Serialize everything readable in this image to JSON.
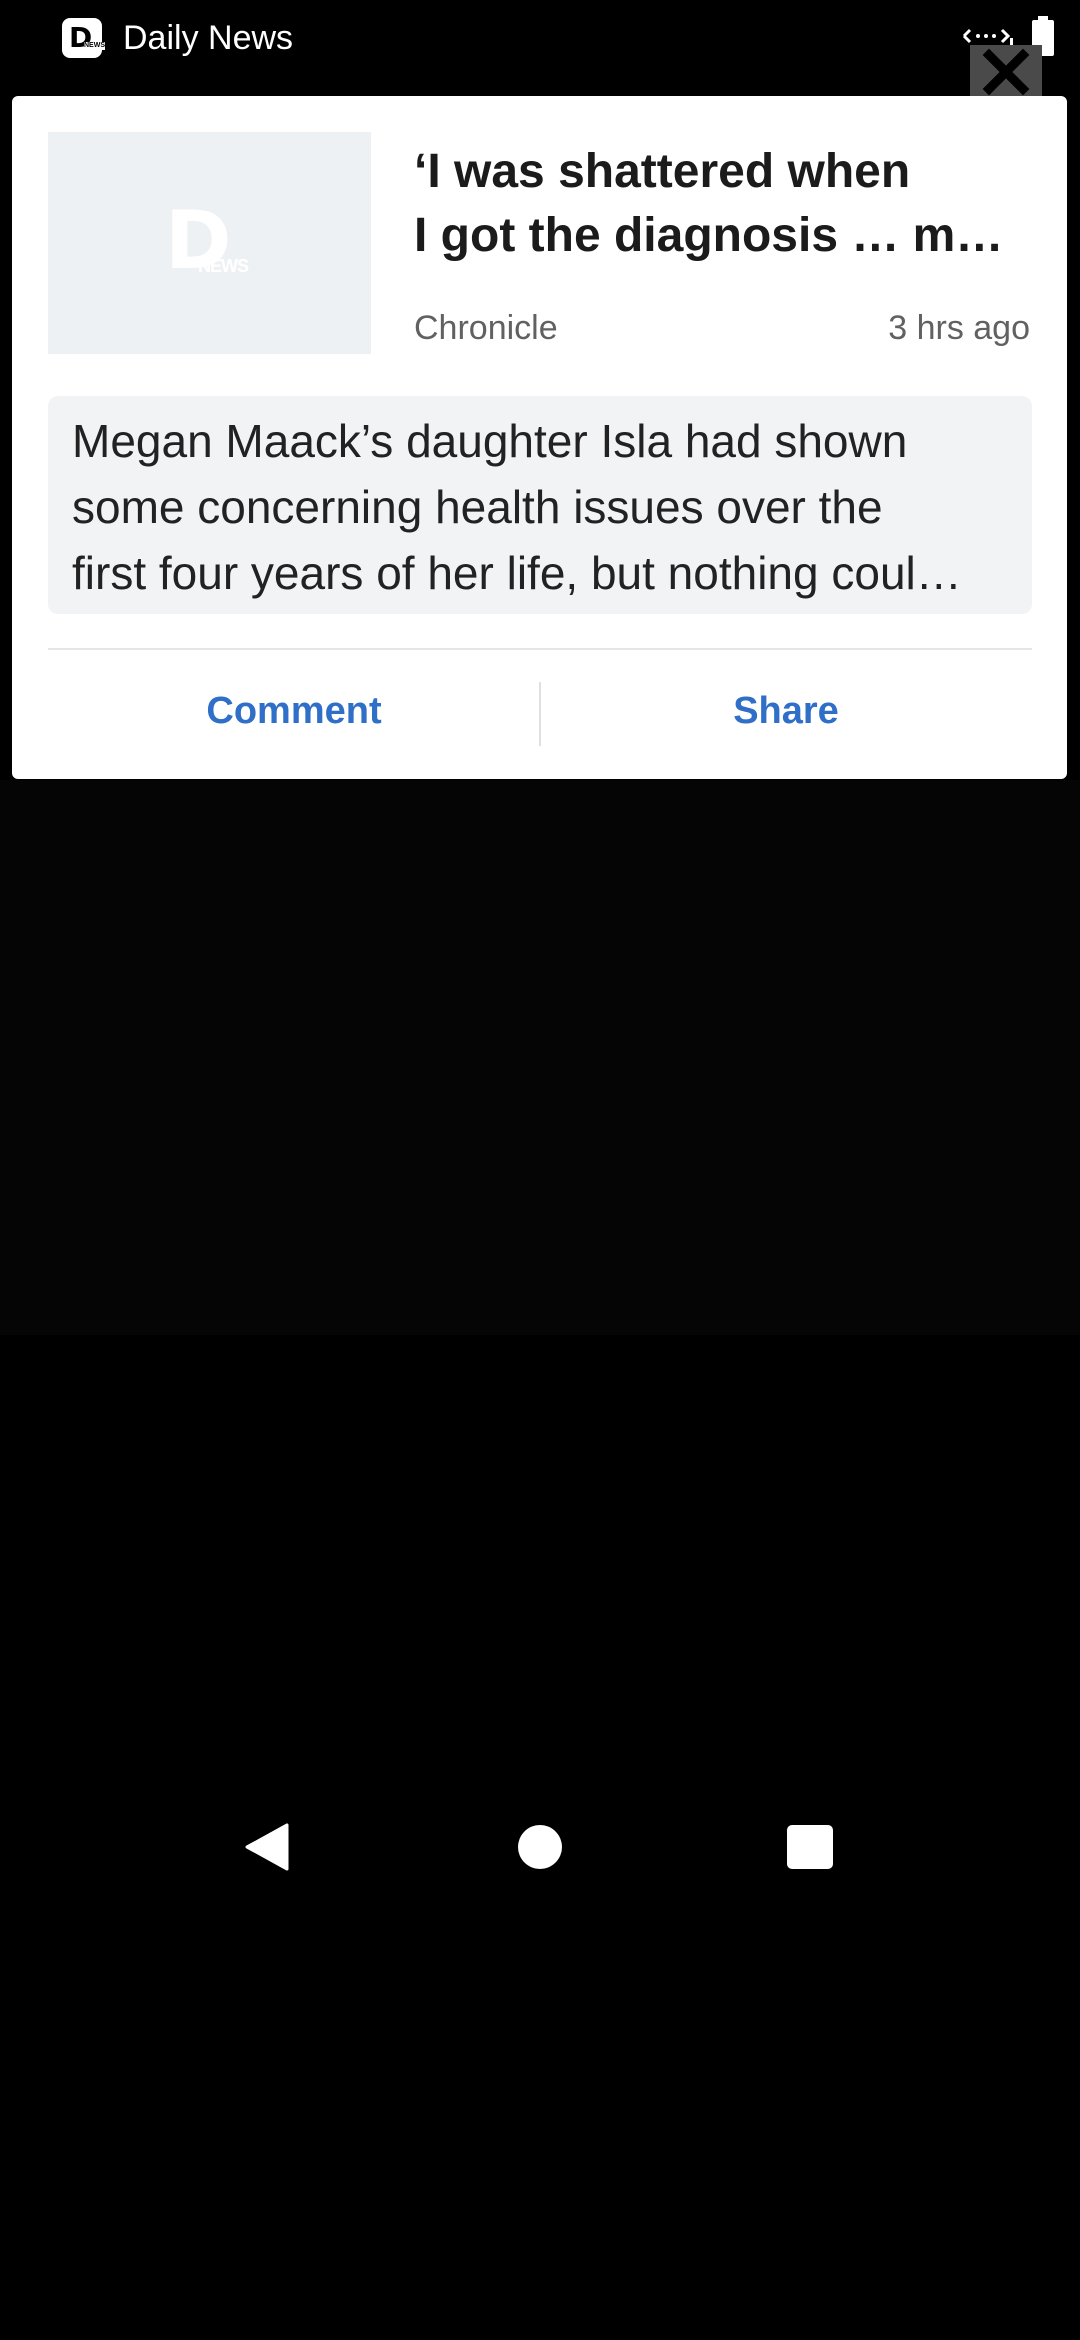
{
  "app": {
    "title": "Daily News",
    "logo_letter": "D",
    "logo_word": "NEWS"
  },
  "card": {
    "headline": "‘I was shattered when\nI got the diagnosis … m…",
    "source": "Chronicle",
    "time": "3 hrs ago",
    "summary": "Megan Maack’s daughter Isla had shown\nsome concerning health issues over the\nfirst four years of her life, but nothing coul…",
    "comment_label": "Comment",
    "share_label": "Share"
  },
  "icons": {
    "status": [
      "wifi-icon",
      "battery-icon"
    ],
    "close": "close-icon",
    "nav": [
      "back-icon",
      "home-icon",
      "recent-apps-icon"
    ]
  },
  "colors": {
    "accent": "#2f6fc7",
    "background": "#000000",
    "card": "#ffffff"
  }
}
